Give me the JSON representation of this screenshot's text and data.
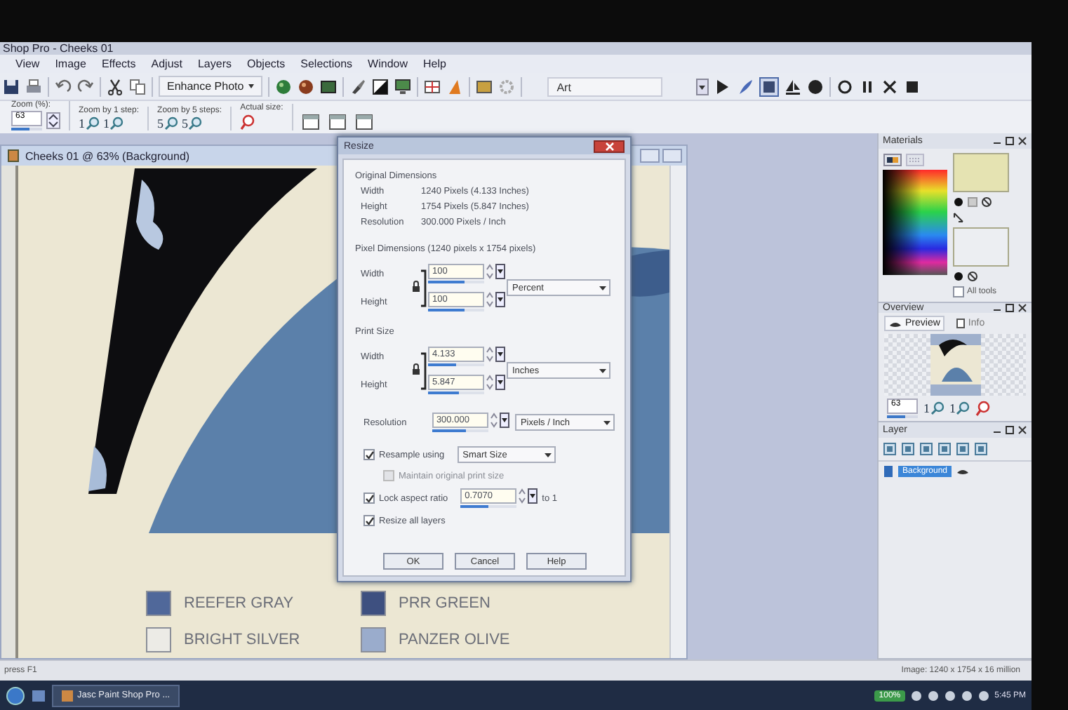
{
  "window": {
    "title": "Shop Pro - Cheeks 01"
  },
  "menu": [
    "View",
    "Image",
    "Effects",
    "Adjust",
    "Layers",
    "Objects",
    "Selections",
    "Window",
    "Help"
  ],
  "toolbar": {
    "enhance": "Enhance Photo",
    "art": "Art"
  },
  "zoom_bar": [
    {
      "kind": "field",
      "label": "Zoom (%):",
      "value": "63",
      "level": 0.6
    },
    {
      "kind": "steps",
      "label": "Zoom by 1 step:",
      "buttons": [
        "1",
        "1"
      ]
    },
    {
      "kind": "steps",
      "label": "Zoom by 5 steps:",
      "buttons": [
        "5",
        "5"
      ]
    },
    {
      "kind": "actual",
      "label": "Actual size:"
    }
  ],
  "image_window": {
    "title": "Cheeks 01 @ 63% (Background)",
    "swatches": [
      {
        "label": "REEFER GRAY",
        "color": "#50689a"
      },
      {
        "label": "PRR GREEN",
        "color": "#3e5080"
      },
      {
        "label": "BRIGHT SILVER",
        "color": "#ecebe6"
      },
      {
        "label": "PANZER OLIVE",
        "color": "#9aaccc"
      }
    ]
  },
  "dialog": {
    "title": "Resize",
    "original": {
      "heading": "Original Dimensions",
      "rows": [
        {
          "label": "Width",
          "value": "1240 Pixels (4.133 Inches)"
        },
        {
          "label": "Height",
          "value": "1754 Pixels (5.847 Inches)"
        },
        {
          "label": "Resolution",
          "value": "300.000 Pixels / Inch"
        }
      ]
    },
    "pixel": {
      "heading": "Pixel Dimensions (1240 pixels x 1754 pixels)",
      "unit": "Percent",
      "fields": [
        {
          "label": "Width",
          "value": "100",
          "level": 0.65
        },
        {
          "label": "Height",
          "value": "100",
          "level": 0.65
        }
      ]
    },
    "print": {
      "heading": "Print Size",
      "unit": "Inches",
      "fields": [
        {
          "label": "Width",
          "value": "4.133",
          "level": 0.5
        },
        {
          "label": "Height",
          "value": "5.847",
          "level": 0.55
        }
      ]
    },
    "resolution": {
      "label": "Resolution",
      "value": "300.000",
      "level": 0.6,
      "unit": "Pixels / Inch"
    },
    "options": [
      {
        "kind": "select",
        "label": "Resample using",
        "checked": true,
        "disabled": false,
        "value": "Smart Size"
      },
      {
        "kind": "plain",
        "label": "Maintain original print size",
        "checked": false,
        "disabled": true
      },
      {
        "kind": "ratio",
        "label": "Lock aspect ratio",
        "checked": true,
        "disabled": false,
        "value": "0.7070",
        "level": 0.5,
        "suffix": "to 1"
      },
      {
        "kind": "plain",
        "label": "Resize all layers",
        "checked": true,
        "disabled": false
      }
    ],
    "buttons": [
      "OK",
      "Cancel",
      "Help"
    ]
  },
  "materials": {
    "title": "Materials",
    "all_tools": {
      "label": "All tools",
      "checked": false
    }
  },
  "overview": {
    "title": "Overview",
    "tabs": [
      {
        "label": "Preview",
        "selected": true
      },
      {
        "label": "Info",
        "selected": false
      }
    ],
    "zoom": {
      "value": "63",
      "level": 0.6
    },
    "buttons": [
      "1",
      "1"
    ]
  },
  "layers": {
    "title": "Layer",
    "items": [
      {
        "name": "Background",
        "selected": true
      }
    ]
  },
  "status_bar": {
    "hint": "press F1",
    "image_info": "Image: 1240 x 1754 x 16 million"
  },
  "taskbar": {
    "task": "Jasc Paint Shop Pro ...",
    "battery": "100%",
    "clock": "5:45 PM"
  }
}
